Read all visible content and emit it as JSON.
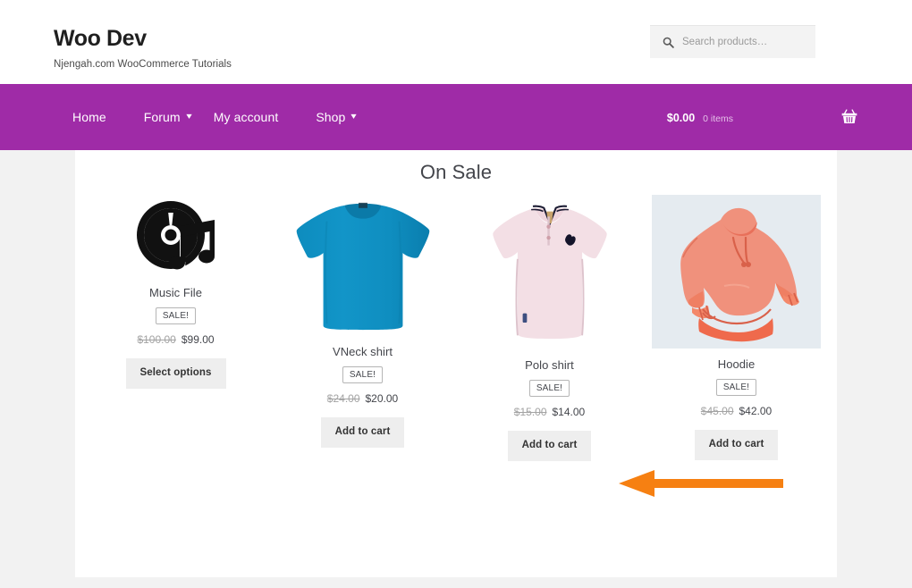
{
  "header": {
    "brand_title": "Woo Dev",
    "brand_tagline": "Njengah.com WooCommerce Tutorials",
    "search": {
      "placeholder": "Search products…",
      "value": "",
      "icon": "search-icon"
    }
  },
  "nav": {
    "items": [
      {
        "label": "Home",
        "has_dropdown": false
      },
      {
        "label": "Forum",
        "has_dropdown": true
      },
      {
        "label": "My account",
        "has_dropdown": false
      },
      {
        "label": "Shop",
        "has_dropdown": true
      }
    ],
    "cart": {
      "amount": "$0.00",
      "count": "0 items",
      "icon": "shopping-basket-icon"
    },
    "background_color": "#9f2ba7"
  },
  "main": {
    "title": "On Sale",
    "products": [
      {
        "name": "Music File",
        "badge": "SALE!",
        "old_price": "$100.00",
        "new_price": "$99.00",
        "button": "Select options",
        "image": "music-file-cd-icon",
        "image_bg": "#ffffff"
      },
      {
        "name": "VNeck shirt",
        "badge": "SALE!",
        "old_price": "$24.00",
        "new_price": "$20.00",
        "button": "Add to cart",
        "image": "blue-tshirt-photo",
        "image_bg": "#ffffff"
      },
      {
        "name": "Polo shirt",
        "badge": "SALE!",
        "old_price": "$15.00",
        "new_price": "$14.00",
        "button": "Add to cart",
        "image": "pink-polo-shirt-photo",
        "image_bg": "#ffffff"
      },
      {
        "name": "Hoodie",
        "badge": "SALE!",
        "old_price": "$45.00",
        "new_price": "$42.00",
        "button": "Add to cart",
        "image": "orange-hoodie-illustration",
        "image_bg": "#e5ebf0"
      }
    ]
  },
  "annotation": {
    "arrow": "left-pointing-arrow",
    "color": "#f68012"
  }
}
